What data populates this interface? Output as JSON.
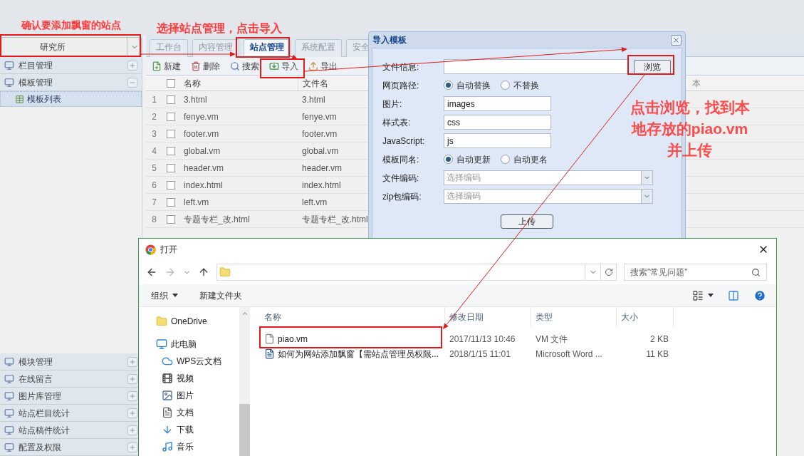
{
  "annotations": {
    "site_note": "确认要添加飘窗的站点",
    "tab_note": "选择站点管理，点击导入",
    "browse_note": [
      "点击浏览，找到本",
      "地存放的piao.vm",
      "并上传"
    ]
  },
  "sidebar": {
    "site": "研究所",
    "groups_top": [
      {
        "label": "栏目管理",
        "expanded": false
      },
      {
        "label": "模板管理",
        "expanded": true,
        "children": [
          {
            "label": "模板列表",
            "selected": true
          }
        ]
      }
    ],
    "groups_bottom": [
      {
        "label": "模块管理",
        "expanded": false
      },
      {
        "label": "在线留言",
        "expanded": false
      },
      {
        "label": "图片库管理",
        "expanded": false
      },
      {
        "label": "站点栏目统计",
        "expanded": false
      },
      {
        "label": "站点稿件统计",
        "expanded": false
      },
      {
        "label": "配置及权限",
        "expanded": false
      }
    ]
  },
  "tabs": [
    {
      "label": "工作台",
      "selected": false
    },
    {
      "label": "内容管理",
      "selected": false
    },
    {
      "label": "站点管理",
      "selected": true
    },
    {
      "label": "系统配置",
      "selected": false
    },
    {
      "label": "安全",
      "selected": false
    }
  ],
  "toolbar": [
    {
      "label": "新建",
      "kind": "new"
    },
    {
      "label": "删除",
      "kind": "delete"
    },
    {
      "label": "搜索",
      "kind": "search"
    },
    {
      "label": "导入",
      "kind": "import"
    },
    {
      "label": "导出",
      "kind": "export"
    }
  ],
  "table": {
    "columns": [
      "名称",
      "文件名",
      "本"
    ],
    "select_all_checked": false,
    "rows": [
      {
        "index": "1",
        "name": "3.html",
        "file": "3.html",
        "checked": false
      },
      {
        "index": "2",
        "name": "fenye.vm",
        "file": "fenye.vm",
        "checked": false
      },
      {
        "index": "3",
        "name": "footer.vm",
        "file": "footer.vm",
        "checked": false
      },
      {
        "index": "4",
        "name": "global.vm",
        "file": "global.vm",
        "checked": false
      },
      {
        "index": "5",
        "name": "header.vm",
        "file": "header.vm",
        "checked": false
      },
      {
        "index": "6",
        "name": "index.html",
        "file": "index.html",
        "checked": false
      },
      {
        "index": "7",
        "name": "left.vm",
        "file": "left.vm",
        "checked": false
      },
      {
        "index": "8",
        "name": "专题专栏_改.html",
        "file": "专题专栏_改.html",
        "checked": false
      }
    ]
  },
  "import_dialog": {
    "title": "导入模板",
    "submit": "上传",
    "fields": [
      {
        "kind": "file",
        "label": "文件信息:",
        "button": "浏览"
      },
      {
        "kind": "radio",
        "label": "网页路径:",
        "options": [
          {
            "label": "自动替换",
            "selected": true
          },
          {
            "label": "不替换",
            "selected": false
          }
        ]
      },
      {
        "kind": "text",
        "label": "图片:",
        "value": "images"
      },
      {
        "kind": "text",
        "label": "样式表:",
        "value": "css"
      },
      {
        "kind": "text",
        "label": "JavaScript:",
        "value": "js"
      },
      {
        "kind": "radio",
        "label": "模板同名:",
        "options": [
          {
            "label": "自动更新",
            "selected": true
          },
          {
            "label": "自动更名",
            "selected": false
          }
        ]
      },
      {
        "kind": "select",
        "label": "文件编码:",
        "placeholder": "选择编码"
      },
      {
        "kind": "select",
        "label": "zip包编码:",
        "placeholder": "选择编码"
      }
    ]
  },
  "file_dialog": {
    "title": "打开",
    "search_placeholder": "搜索\"常见问题\"",
    "organize": "组织",
    "new_folder": "新建文件夹",
    "nav": [
      {
        "label": "OneDrive",
        "kind": "folder"
      },
      {
        "label": "此电脑",
        "kind": "pc",
        "children": [
          {
            "label": "WPS云文档",
            "kind": "cloud"
          },
          {
            "label": "视频",
            "kind": "video"
          },
          {
            "label": "图片",
            "kind": "picture"
          },
          {
            "label": "文档",
            "kind": "document"
          },
          {
            "label": "下载",
            "kind": "download"
          },
          {
            "label": "音乐",
            "kind": "music"
          }
        ]
      }
    ],
    "columns": [
      "名称",
      "修改日期",
      "类型",
      "大小"
    ],
    "files": [
      {
        "name": "piao.vm",
        "date": "2017/11/13 10:46",
        "type": "VM 文件",
        "size": "2 KB",
        "kind": "file"
      },
      {
        "name": "如何为网站添加飘窗【需站点管理员权限...",
        "date": "2018/1/15 11:01",
        "type": "Microsoft Word ...",
        "size": "11 KB",
        "kind": "word"
      }
    ]
  }
}
